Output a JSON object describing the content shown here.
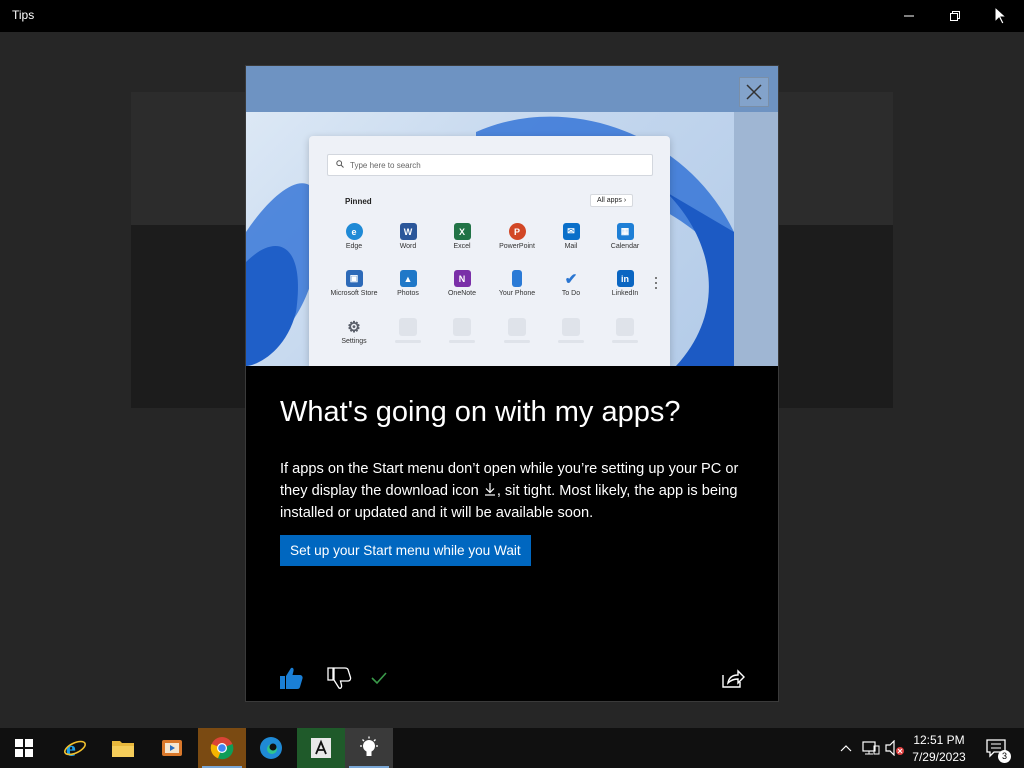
{
  "window": {
    "title": "Tips"
  },
  "background_cards": 2,
  "dialog": {
    "hero": {
      "search_placeholder": "Type here to search",
      "pinned_label": "Pinned",
      "all_apps_label": "All apps",
      "apps": [
        {
          "label": "Edge",
          "icon": "edge-icon",
          "color": "#1f8ad6"
        },
        {
          "label": "Word",
          "icon": "word-icon",
          "color": "#2b579a"
        },
        {
          "label": "Excel",
          "icon": "excel-icon",
          "color": "#217346"
        },
        {
          "label": "PowerPoint",
          "icon": "powerpoint-icon",
          "color": "#d24726"
        },
        {
          "label": "Mail",
          "icon": "mail-icon",
          "color": "#0a6fc9"
        },
        {
          "label": "Calendar",
          "icon": "calendar-icon",
          "color": "#1e7fd6"
        },
        {
          "label": "Microsoft Store",
          "icon": "store-icon",
          "color": "#2d6ab8"
        },
        {
          "label": "Photos",
          "icon": "photos-icon",
          "color": "#1f78c8"
        },
        {
          "label": "OneNote",
          "icon": "onenote-icon",
          "color": "#7a2fa8"
        },
        {
          "label": "Your Phone",
          "icon": "phone-icon",
          "color": "#2a7ad6"
        },
        {
          "label": "To Do",
          "icon": "todo-icon",
          "color": "#2a76d2"
        },
        {
          "label": "LinkedIn",
          "icon": "linkedin-icon",
          "color": "#0a66c2"
        },
        {
          "label": "Settings",
          "icon": "settings-icon",
          "color": "#5a5f6a"
        }
      ]
    },
    "heading": "What's going on with my apps?",
    "body_before_icon": "If apps on the Start menu don’t open while you’re setting up your PC or they display the download icon ",
    "body_after_icon": ", sit tight. Most likely, the app is being installed or updated and it will be available soon.",
    "cta_label": "Set up your Start menu while you Wait"
  },
  "taskbar": {
    "apps": [
      {
        "name": "internet-explorer",
        "icon": "ie-icon"
      },
      {
        "name": "file-explorer",
        "icon": "folder-icon"
      },
      {
        "name": "media-player",
        "icon": "media-icon"
      },
      {
        "name": "chrome",
        "icon": "chrome-icon"
      },
      {
        "name": "edge",
        "icon": "edge-icon"
      },
      {
        "name": "acrobat",
        "icon": "acrobat-icon"
      },
      {
        "name": "tips",
        "icon": "lightbulb-icon"
      }
    ],
    "time": "12:51 PM",
    "date": "7/29/2023",
    "notification_count": "3"
  },
  "colors": {
    "accent": "#0067c0",
    "thumbs_up": "#1a7fd6",
    "check": "#3a9a4a"
  }
}
